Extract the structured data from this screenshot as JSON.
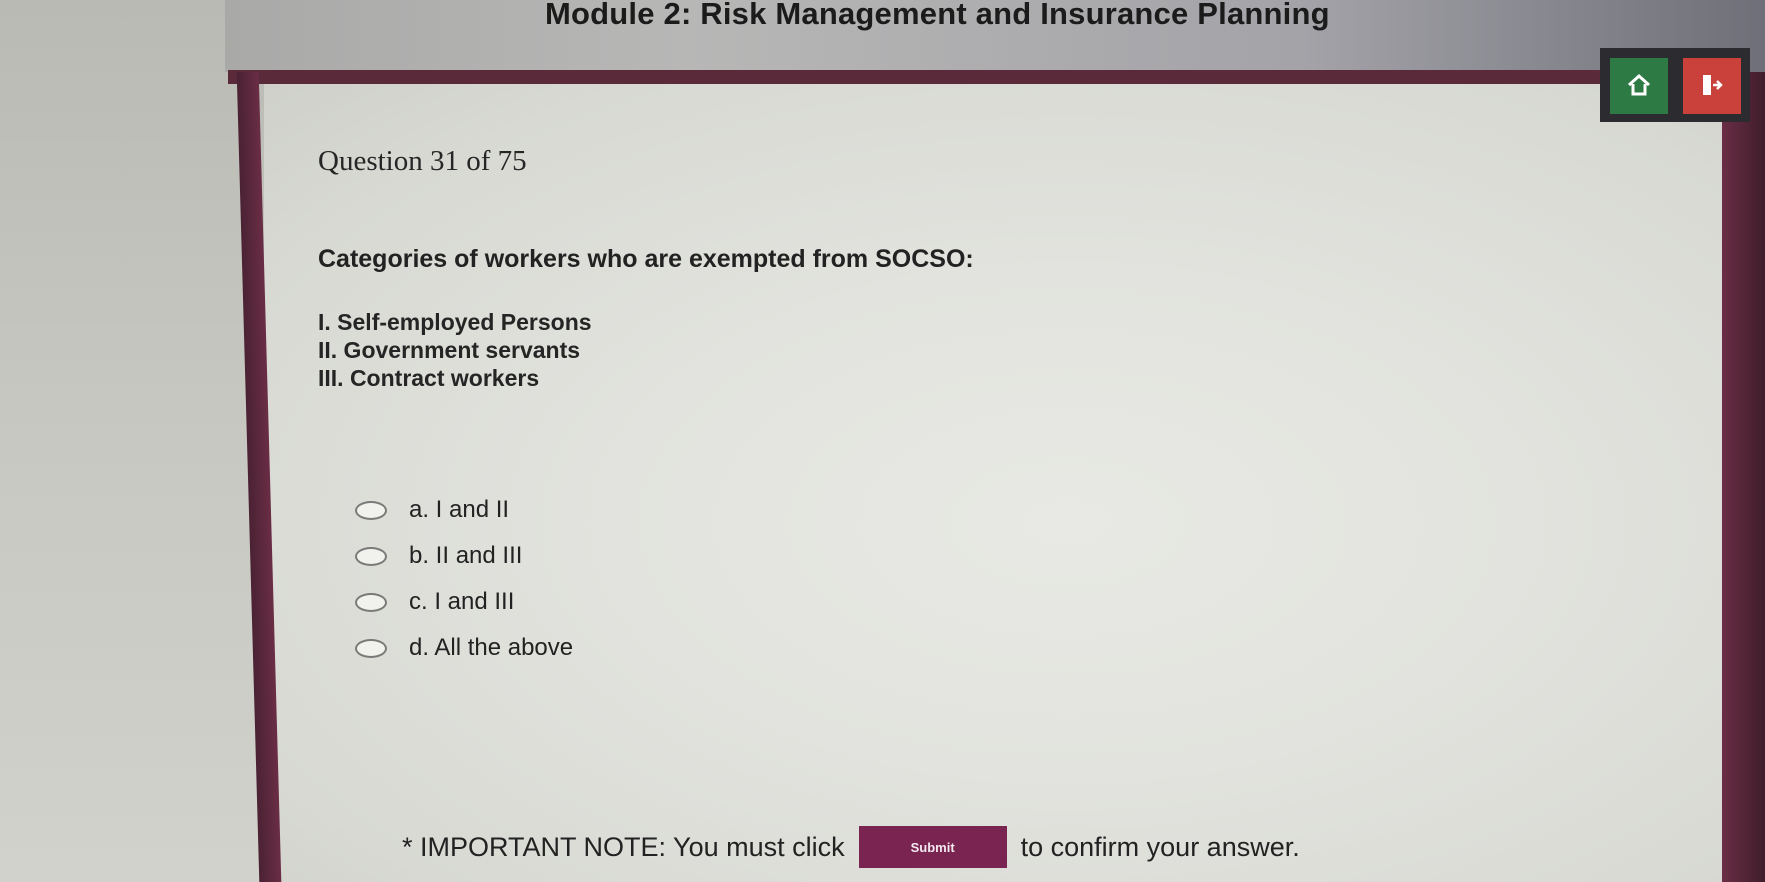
{
  "header": {
    "title": "Module 2: Risk Management and Insurance Planning"
  },
  "nav": {
    "home_icon": "home-icon",
    "exit_icon": "exit-icon",
    "colors": {
      "home": "#2d7a45",
      "exit": "#c9413a",
      "frame": "#5a2a3a"
    }
  },
  "question": {
    "counter": "Question 31 of 75",
    "text": "Categories of workers who are exempted from SOCSO:",
    "statements": [
      "I. Self-employed Persons",
      "II. Government servants",
      "III. Contract workers"
    ],
    "options": [
      "a. I and II",
      "b. II and III",
      "c. I and III",
      "d. All the above"
    ]
  },
  "footer": {
    "note_before": "* IMPORTANT NOTE: You must click",
    "submit_label": "Submit",
    "note_after": "to confirm your answer."
  }
}
